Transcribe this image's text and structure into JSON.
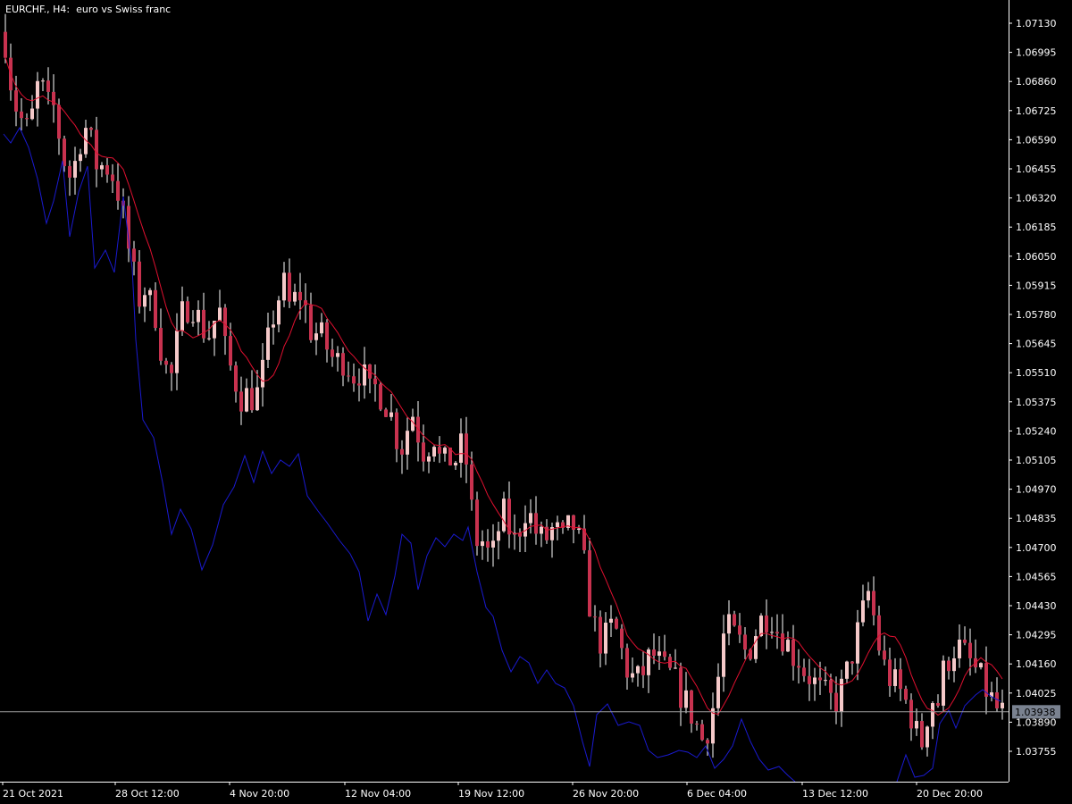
{
  "title": {
    "symbol": "EURCHF.,",
    "timeframe": "H4:",
    "description": "euro vs Swiss franc"
  },
  "current_price_label": "1.03938",
  "colors": {
    "background": "#000000",
    "axis": "#ffffff",
    "bull_candle": "#f5c9c9",
    "bear_candle": "#c8324f",
    "wick": "#ffffff",
    "ma_line": "#e01030",
    "oscillator_line": "#1a1ad0",
    "price_line": "#a0a0a0",
    "price_badge": "#7a8290"
  },
  "chart_data": {
    "type": "candlestick",
    "symbol": "EURCHF.",
    "timeframe": "H4",
    "y_ticks": [
      "1.07130",
      "1.06995",
      "1.06860",
      "1.06725",
      "1.06590",
      "1.06455",
      "1.06320",
      "1.06185",
      "1.06050",
      "1.05915",
      "1.05780",
      "1.05645",
      "1.05510",
      "1.05375",
      "1.05240",
      "1.05105",
      "1.04970",
      "1.04835",
      "1.04700",
      "1.04565",
      "1.04430",
      "1.04295",
      "1.04160",
      "1.04025",
      "1.03890",
      "1.03755"
    ],
    "x_ticks": [
      "21 Oct 2021",
      "28 Oct 12:00",
      "4 Nov 20:00",
      "12 Nov 04:00",
      "19 Nov 12:00",
      "26 Nov 20:00",
      "6 Dec 04:00",
      "13 Dec 12:00",
      "20 Dec 20:00"
    ],
    "ylim": [
      1.0363,
      1.0725
    ],
    "current_price": 1.03938,
    "close_path": [
      1.0705,
      1.0685,
      1.0673,
      1.0667,
      1.0662,
      1.0675,
      1.069,
      1.0672,
      1.0678,
      1.0665,
      1.0651,
      1.0642,
      1.0648,
      1.066,
      1.0665,
      1.0655,
      1.0645,
      1.0648,
      1.0645,
      1.064,
      1.0628,
      1.0612,
      1.0598,
      1.0585,
      1.059,
      1.0583,
      1.0578,
      1.056,
      1.055,
      1.0549,
      1.0575,
      1.058,
      1.0585,
      1.0578,
      1.0572,
      1.0568,
      1.0575,
      1.0579,
      1.056,
      1.0552,
      1.0545,
      1.0538,
      1.0542,
      1.0538,
      1.0545,
      1.056,
      1.0575,
      1.0585,
      1.0592,
      1.0582,
      1.0585,
      1.0588,
      1.0578,
      1.0568,
      1.057,
      1.0565,
      1.056,
      1.0555,
      1.0558,
      1.0555,
      1.055,
      1.0552,
      1.0548,
      1.054,
      1.0545,
      1.054,
      1.0535,
      1.0528,
      1.0515,
      1.052,
      1.0535,
      1.0525,
      1.0515,
      1.0518,
      1.0522,
      1.051,
      1.0508,
      1.0512,
      1.051,
      1.052,
      1.05,
      1.0472,
      1.0475,
      1.0468,
      1.0465,
      1.0478,
      1.0485,
      1.0478,
      1.0472,
      1.0482,
      1.049,
      1.048,
      1.0475,
      1.0472,
      1.0478,
      1.0478,
      1.0472,
      1.0478,
      1.048,
      1.0472,
      1.046,
      1.044,
      1.043,
      1.0425,
      1.043,
      1.0435,
      1.0425,
      1.0415,
      1.041,
      1.0408,
      1.0412,
      1.0418,
      1.042,
      1.0415,
      1.0412,
      1.041,
      1.0405,
      1.04,
      1.0395,
      1.039,
      1.038,
      1.0385,
      1.0395,
      1.041,
      1.043,
      1.0432,
      1.0428,
      1.0425,
      1.042,
      1.0428,
      1.0435,
      1.0438,
      1.044,
      1.0432,
      1.043,
      1.0425,
      1.042,
      1.0418,
      1.0412,
      1.041,
      1.0405,
      1.0402,
      1.04,
      1.0398,
      1.0402,
      1.041,
      1.042,
      1.043,
      1.044,
      1.045,
      1.0435,
      1.042,
      1.0412,
      1.0408,
      1.0405,
      1.04,
      1.0395,
      1.0385,
      1.0378,
      1.0392,
      1.04,
      1.0398,
      1.0415,
      1.042,
      1.0425,
      1.0422,
      1.0418,
      1.0415,
      1.041,
      1.0405,
      1.04,
      1.0395,
      1.0393
    ]
  }
}
